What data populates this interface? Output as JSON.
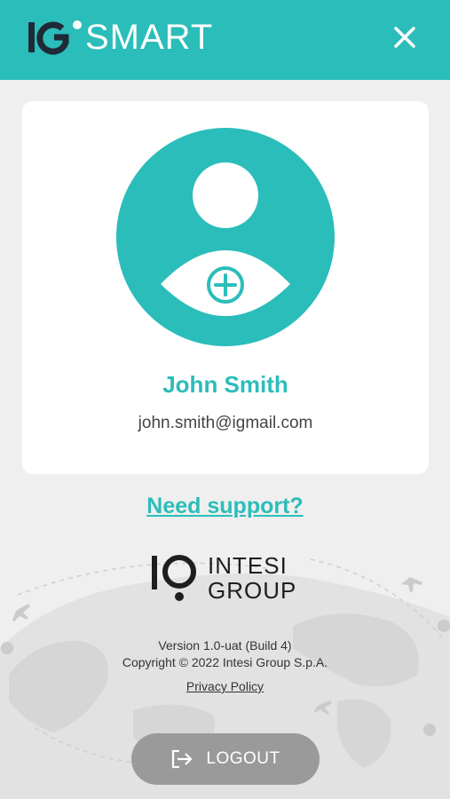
{
  "header": {
    "logo_text": "SMART",
    "logo_mark": "IG",
    "close_icon": "close-icon"
  },
  "profile": {
    "name": "John Smith",
    "email": "john.smith@igmail.com",
    "avatar_icon": "user-avatar-add-icon"
  },
  "support": {
    "link_label": "Need support?"
  },
  "brand": {
    "line1": "INTESI",
    "line2": "GROUP"
  },
  "footer": {
    "version": "Version 1.0-uat (Build 4)",
    "copyright": "Copyright © 2022 Intesi Group S.p.A.",
    "privacy_label": "Privacy Policy"
  },
  "logout": {
    "label": "LOGOUT",
    "icon": "logout-icon"
  },
  "colors": {
    "accent": "#2bbdba",
    "background": "#efefef",
    "card": "#ffffff",
    "button": "#9a9a9a"
  }
}
